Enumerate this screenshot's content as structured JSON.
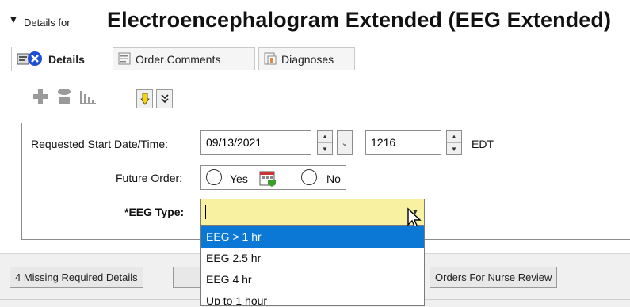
{
  "header": {
    "collapse_symbol": "▼",
    "prefix": "Details for",
    "title": "Electroencephalogram Extended (EEG Extended)"
  },
  "tabs": [
    {
      "label": "Details",
      "icon": "details-error-icon",
      "active": true
    },
    {
      "label": "Order Comments",
      "icon": "comments-icon",
      "active": false
    },
    {
      "label": "Diagnoses",
      "icon": "diagnoses-icon",
      "active": false
    }
  ],
  "toolbar": {
    "icons": [
      "add-icon",
      "remove-icon",
      "chart-icon"
    ],
    "next_required_icon": "yellow-down-arrow-icon",
    "expand_icon": "double-chevron-down-icon"
  },
  "form": {
    "start_label": "Requested Start Date/Time:",
    "start_date": "09/13/2021",
    "start_time": "1216",
    "timezone": "EDT",
    "future_label": "Future Order:",
    "yes_label": "Yes",
    "no_label": "No",
    "eeg_type_label": "*EEG Type:",
    "eeg_type_value": "",
    "eeg_options": [
      "EEG > 1 hr",
      "EEG 2.5 hr",
      "EEG 4 hr",
      "Up to 1 hour"
    ],
    "selected_option": 0
  },
  "status": {
    "missing_label": "4 Missing Required Details",
    "nurse_review_label": "Orders For Nurse Review"
  },
  "colors": {
    "required_field": "#f7f1a1",
    "selection": "#0a78d4",
    "error_badge": "#1f4fd1"
  }
}
